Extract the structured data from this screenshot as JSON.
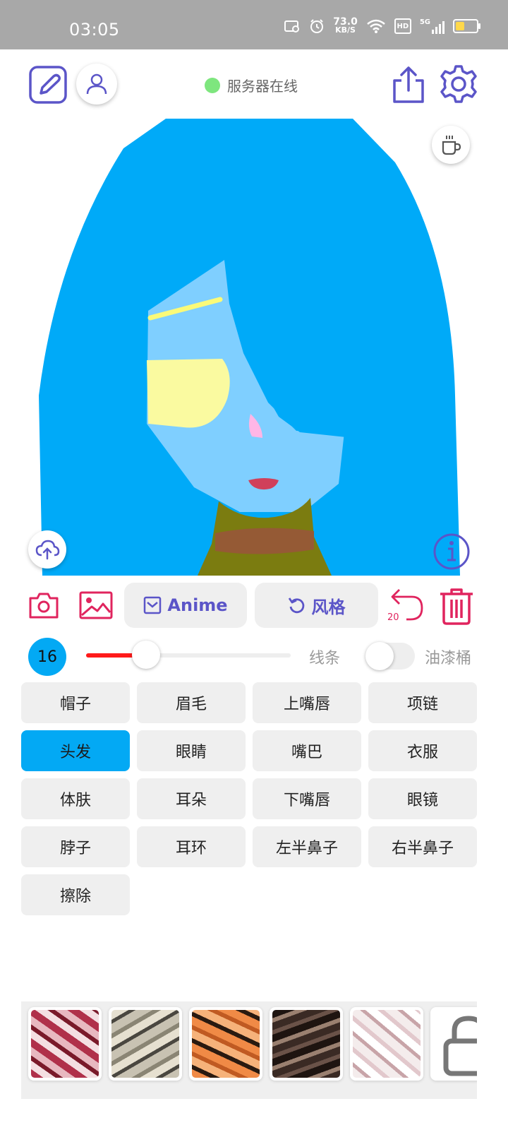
{
  "status_bar": {
    "time": "03:05",
    "net_speed": "73.0",
    "net_unit": "KB/S",
    "hd": "HD",
    "signal": "5G"
  },
  "header": {
    "server_status": "服务器在线",
    "server_color": "#7ee67e",
    "icons": [
      "edit-icon",
      "user-icon",
      "share-icon",
      "settings-icon",
      "coffee-icon",
      "cloud-upload-icon",
      "info-icon"
    ]
  },
  "toolbar": {
    "anime_label": "Anime",
    "style_label": "风格",
    "undo_count": "20",
    "accent": "#5b55c8",
    "danger": "#e0245e"
  },
  "brush": {
    "size": "16",
    "slider_level": 0.26,
    "line_label": "线条",
    "bucket_label": "油漆桶",
    "bucket_enabled": false
  },
  "parts": [
    {
      "label": "帽子",
      "active": false
    },
    {
      "label": "眉毛",
      "active": false
    },
    {
      "label": "上嘴唇",
      "active": false
    },
    {
      "label": "项链",
      "active": false
    },
    {
      "label": "头发",
      "active": true
    },
    {
      "label": "眼睛",
      "active": false
    },
    {
      "label": "嘴巴",
      "active": false
    },
    {
      "label": "衣服",
      "active": false
    },
    {
      "label": "体肤",
      "active": false
    },
    {
      "label": "耳朵",
      "active": false
    },
    {
      "label": "下嘴唇",
      "active": false
    },
    {
      "label": "眼镜",
      "active": false
    },
    {
      "label": "脖子",
      "active": false
    },
    {
      "label": "耳环",
      "active": false
    },
    {
      "label": "左半鼻子",
      "active": false
    },
    {
      "label": "右半鼻子",
      "active": false
    },
    {
      "label": "擦除",
      "active": false
    }
  ],
  "style_thumbnails": [
    "red-ink",
    "grey-stone",
    "orange-tiger",
    "dark-brown",
    "pale-pink",
    "locked"
  ],
  "colors": {
    "hair": "#00aaf8",
    "skin": "#7fcfff",
    "eye": "#fafaa0",
    "brow": "#fafa78",
    "nose": "#ffb6e6",
    "mouth": "#d0405a",
    "clothes": "#7b7c10",
    "scarf": "#955a35",
    "active_part": "#03a9f4",
    "slider_fill": "#ff1a1a"
  }
}
